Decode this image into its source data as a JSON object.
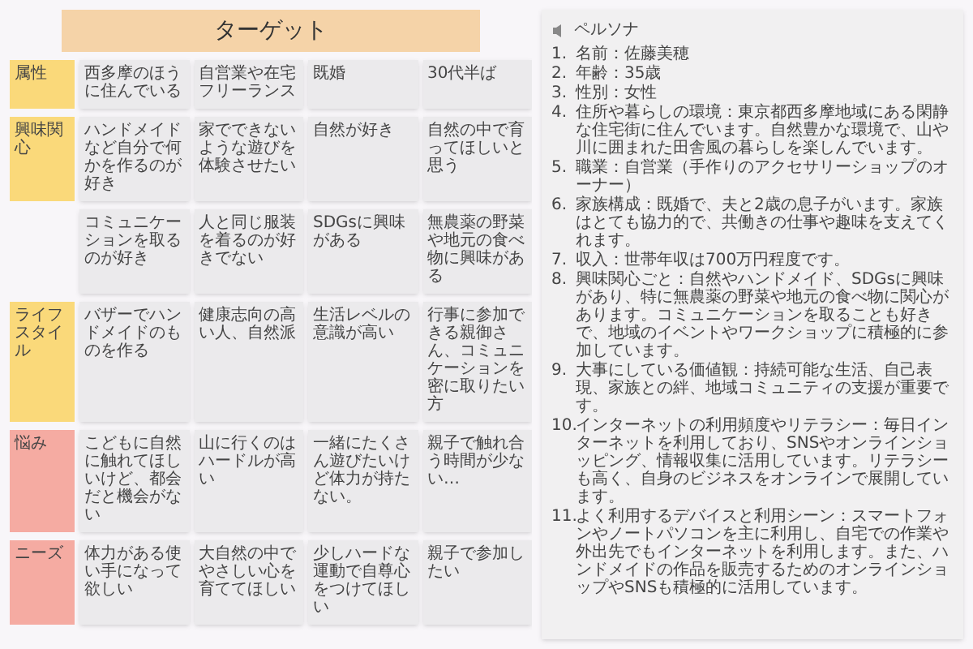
{
  "board": {
    "title": "ターゲット",
    "rows": [
      {
        "label": "属性",
        "color": "#fad97a",
        "cards": [
          "西多摩のほうに住んでいる",
          "自営業や在宅フリーランス",
          "既婚",
          "30代半ば"
        ]
      },
      {
        "label": "興味関心",
        "color": "#fad97a",
        "cards": [
          "ハンドメイドなど自分で何かを作るのが好き",
          "家でできないような遊びを体験させたい",
          "自然が好き",
          "自然の中で育ってほしいと思う"
        ]
      },
      {
        "cards": [
          "コミュニケーションを取るのが好き",
          "人と同じ服装を着るのが好きでない",
          "SDGsに興味がある",
          "無農薬の野菜や地元の食べ物に興味がある"
        ]
      },
      {
        "label": "ライフスタイル",
        "color": "#fad97a",
        "cards": [
          "バザーでハンドメイドのものを作る",
          "健康志向の高い人、自然派",
          "生活レベルの意識が高い",
          "行事に参加できる親御さん、コミュニケーションを密に取りたい方"
        ]
      },
      {
        "label": "悩み",
        "color": "#f5aba2",
        "cards": [
          "こどもに自然に触れてほしいけど、都会だと機会がない",
          "山に行くのはハードルが高い",
          "一緒にたくさん遊びたいけど体力が持たない。",
          "親子で触れ合う時間が少ない…"
        ]
      },
      {
        "label": "ニーズ",
        "color": "#f5aba2",
        "cards": [
          "体力がある使い手になって欲しい",
          "大自然の中でやさしい心を育ててほしい",
          "少しハードな運動で自尊心をつけてほしい",
          "親子で参加したい"
        ]
      }
    ]
  },
  "persona": {
    "title": "ペルソナ",
    "items": [
      {
        "number": "1.",
        "text": "名前：佐藤美穂"
      },
      {
        "number": "2.",
        "text": "年齢：35歳"
      },
      {
        "number": "3.",
        "text": "性別：女性"
      },
      {
        "number": "4.",
        "text": "住所や暮らしの環境：東京都西多摩地域にある閑静な住宅街に住んでいます。自然豊かな環境で、山や川に囲まれた田舎風の暮らしを楽しんでいます。"
      },
      {
        "number": "5.",
        "text": "職業：自営業（手作りのアクセサリーショップのオーナー）"
      },
      {
        "number": "6.",
        "text": "家族構成：既婚で、夫と2歳の息子がいます。家族はとても協力的で、共働きの仕事や趣味を支えてくれます。"
      },
      {
        "number": "7.",
        "text": "収入：世帯年収は700万円程度です。"
      },
      {
        "number": "8.",
        "text": "興味関心ごと：自然やハンドメイド、SDGsに興味があり、特に無農薬の野菜や地元の食べ物に関心があります。コミュニケーションを取ることも好きで、地域のイベントやワークショップに積極的に参加しています。"
      },
      {
        "number": "9.",
        "text": "大事にしている価値観：持続可能な生活、自己表現、家族との絆、地域コミュニティの支援が重要です。"
      },
      {
        "number": "10.",
        "text": "インターネットの利用頻度やリテラシー：毎日インターネットを利用しており、SNSやオンラインショッピング、情報収集に活用しています。リテラシーも高く、自身のビジネスをオンラインで展開しています。"
      },
      {
        "number": "11.",
        "text": "よく利用するデバイスと利用シーン：スマートフォンやノートパソコンを主に利用し、自宅での作業や外出先でもインターネットを利用します。また、ハンドメイドの作品を販売するためのオンラインショップやSNSも積極的に活用しています。"
      }
    ]
  }
}
